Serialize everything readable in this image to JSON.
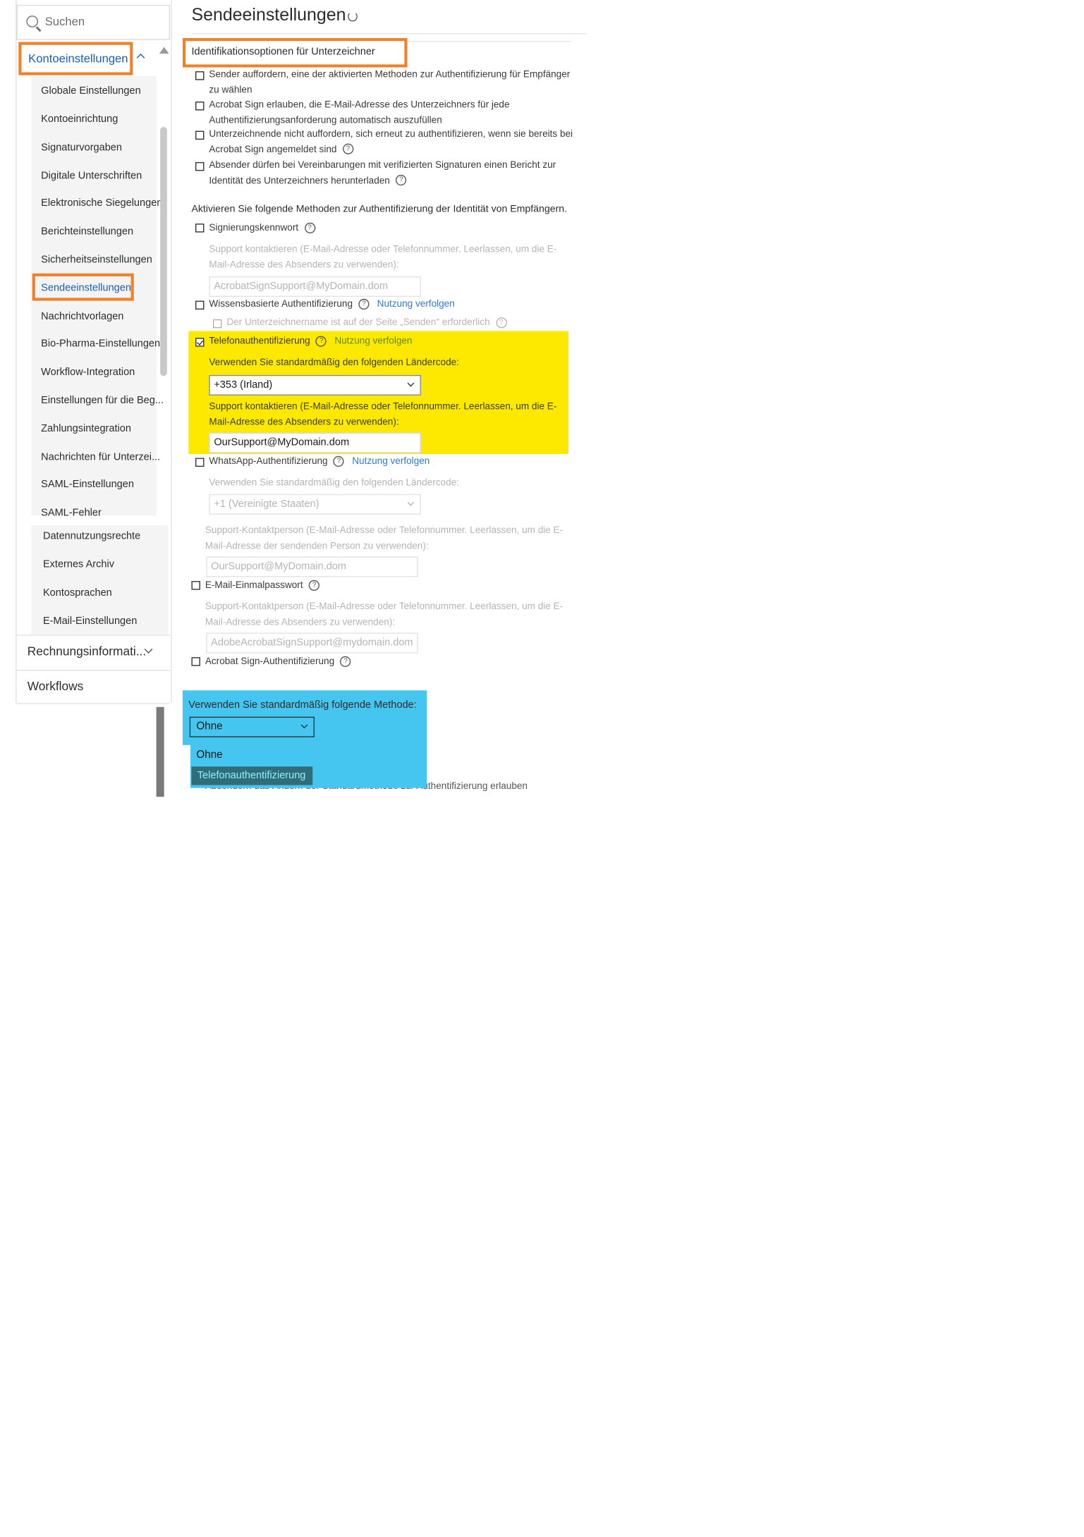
{
  "sidebar": {
    "search_placeholder": "Suchen",
    "active_section": "Kontoeinstellungen",
    "items": [
      "Globale Einstellungen",
      "Kontoeinrichtung",
      "Signaturvorgaben",
      "Digitale Unterschriften",
      "Elektronische Siegelungen",
      "Berichteinstellungen",
      "Sicherheitseinstellungen",
      "Sendeeinstellungen",
      "Nachrichtvorlagen",
      "Bio-Pharma-Einstellungen",
      "Workflow-Integration",
      "Einstellungen für die Beg...",
      "Zahlungsintegration",
      "Nachrichten für Unterzei...",
      "SAML-Einstellungen",
      "SAML-Fehler"
    ],
    "items_extra": [
      "Datennutzungsrechte",
      "Externes Archiv",
      "Kontosprachen",
      "E-Mail-Einstellungen"
    ],
    "section_billing": "Rechnungsinformati...",
    "section_workflows": "Workflows"
  },
  "main": {
    "title": "Sendeeinstellungen",
    "identification_heading": "Identifikationsoptionen für Unterzeichner",
    "options": [
      "Sender auffordern, eine der aktivierten Methoden zur Authentifizierung für Empfänger zu wählen",
      "Acrobat Sign erlauben, die E-Mail-Adresse des Unterzeichners für jede Authentifizierungsanforderung automatisch auszufüllen",
      "Unterzeichnende nicht auffordern, sich erneut zu authentifizieren, wenn sie bereits bei Acrobat Sign angemeldet sind",
      "Absender dürfen bei Vereinbarungen mit verifizierten Signaturen einen Bericht zur Identität des Unterzeichners herunterladen"
    ],
    "methods_heading": "Aktivieren Sie folgende Methoden zur Authentifizierung der Identität von Empfängern.",
    "password": {
      "label": "Signierungskennwort",
      "support_text": "Support kontaktieren (E-Mail-Adresse oder Telefonnummer. Leerlassen, um die E-Mail-Adresse des Absenders zu verwenden):",
      "support_value": "AcrobatSignSupport@MyDomain.dom"
    },
    "kba": {
      "label": "Wissensbasierte Authentifizierung",
      "link": "Nutzung verfolgen",
      "sub_label": "Der Unterzeichnername ist auf der Seite „Senden“ erforderlich"
    },
    "phone": {
      "label": "Telefonauthentifizierung",
      "link": "Nutzung verfolgen",
      "country_label": "Verwenden Sie standardmäßig den folgenden Ländercode:",
      "country_value": "+353 (Irland)",
      "support_text": "Support kontaktieren (E-Mail-Adresse oder Telefonnummer. Leerlassen, um die E-Mail-Adresse des Absenders zu verwenden):",
      "support_value": "OurSupport@MyDomain.dom"
    },
    "whatsapp": {
      "label": "WhatsApp-Authentifizierung",
      "link": "Nutzung verfolgen",
      "country_label": "Verwenden Sie standardmäßig den folgenden Ländercode:",
      "country_value": "+1 (Vereinigte Staaten)",
      "support_text": "Support-Kontaktperson (E-Mail-Adresse oder Telefonnummer. Leerlassen, um die E-Mail-Adresse der sendenden Person zu verwenden):",
      "support_value": "OurSupport@MyDomain.dom"
    },
    "email_otp": {
      "label": "E-Mail-Einmalpasswort",
      "support_text": "Support-Kontaktperson (E-Mail-Adresse oder Telefonnummer. Leerlassen, um die E-Mail-Adresse des Absenders zu verwenden):",
      "support_value": "AdobeAcrobatSignSupport@mydomain.dom"
    },
    "acrobat_auth": {
      "label": "Acrobat Sign-Authentifizierung"
    },
    "default_method": {
      "label": "Verwenden Sie standardmäßig folgende Methode:",
      "selected": "Ohne",
      "options": [
        "Ohne",
        "Telefonauthentifizierung"
      ]
    },
    "allow_change_text": "Absendern das Ändern der Standardmethode zur Authentifizierung erlauben"
  },
  "colors": {
    "highlight_orange": "#f08127",
    "highlight_yellow": "#fde900",
    "highlight_blue": "#45c6f0",
    "link_blue": "#2f7ad1",
    "link_green": "#5d8c1e"
  }
}
